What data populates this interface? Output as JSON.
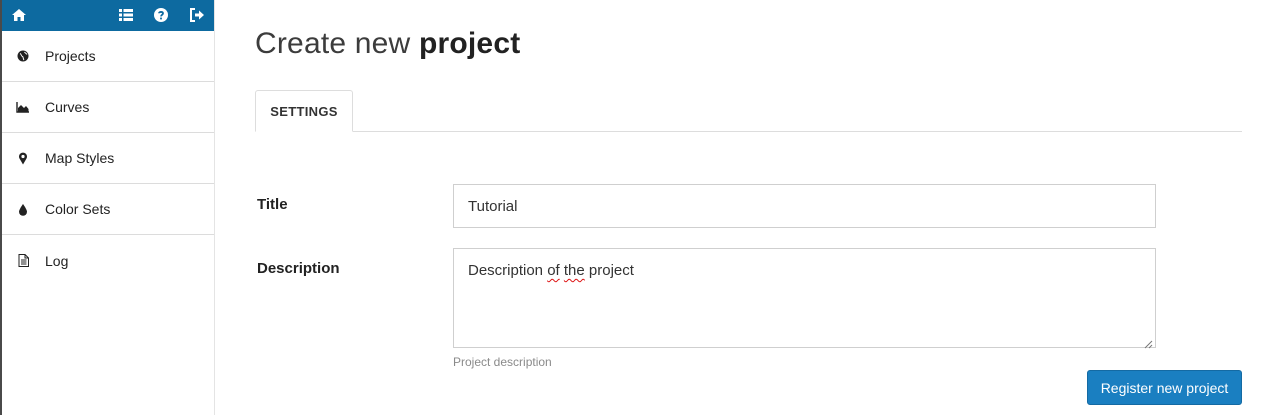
{
  "topbar": {
    "icons": [
      "home-icon",
      "list-icon",
      "help-icon",
      "logout-icon"
    ],
    "background_color": "#0d6aa0"
  },
  "sidebar": {
    "items": [
      {
        "label": "Projects",
        "icon": "globe-icon"
      },
      {
        "label": "Curves",
        "icon": "area-chart-icon"
      },
      {
        "label": "Map Styles",
        "icon": "map-marker-icon"
      },
      {
        "label": "Color Sets",
        "icon": "tint-icon"
      },
      {
        "label": "Log",
        "icon": "file-text-icon"
      }
    ]
  },
  "page": {
    "title_light": "Create new",
    "title_bold": "project"
  },
  "tabs": [
    {
      "label": "SETTINGS",
      "active": true
    }
  ],
  "form": {
    "title_label": "Title",
    "title_value": "Tutorial",
    "description_label": "Description",
    "description_value_pre": "Description ",
    "description_value_misspelled_1": "of",
    "description_value_space": " ",
    "description_value_misspelled_2": "the",
    "description_value_post": " project",
    "description_help": "Project description",
    "submit_label": "Register new project"
  },
  "colors": {
    "primary_button": "#1a7fc1",
    "topbar": "#0d6aa0"
  }
}
